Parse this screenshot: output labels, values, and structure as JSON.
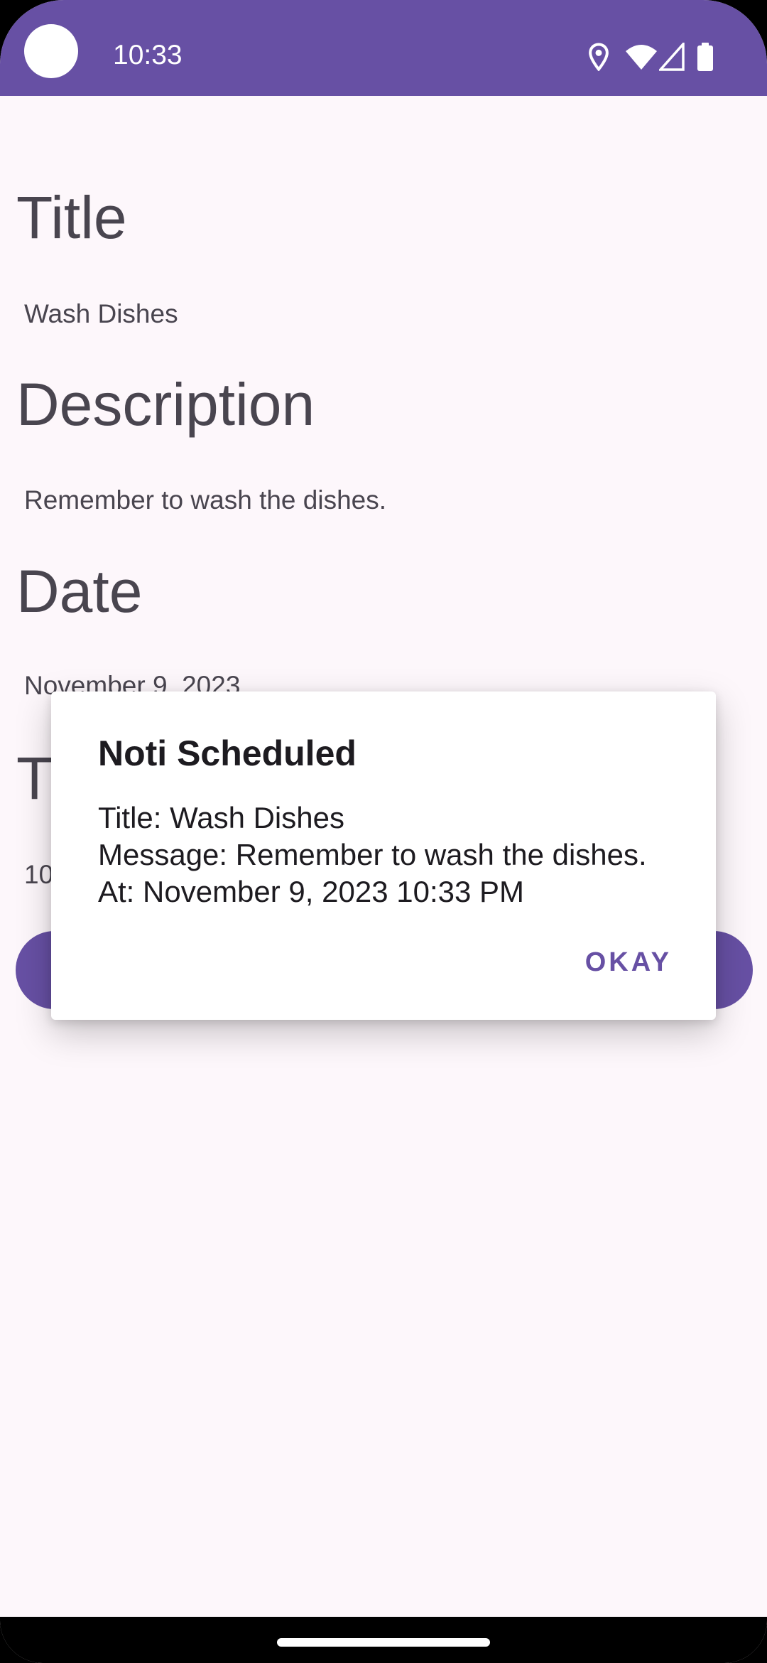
{
  "status_bar": {
    "time": "10:33",
    "icons": [
      "location-icon",
      "wifi-icon",
      "cellular-signal-icon",
      "battery-icon"
    ],
    "background": "#6750a4"
  },
  "form": {
    "title_heading": "Title",
    "title_value": "Wash Dishes",
    "description_heading": "Description",
    "description_value": "Remember to wash the dishes.",
    "date_heading": "Date",
    "date_value": "November 9, 2023",
    "time_heading": "Time",
    "time_value": "10:33 PM"
  },
  "dialog": {
    "title": "Noti Scheduled",
    "line_title": "Title: Wash Dishes",
    "line_message": "Message: Remember to wash the dishes.",
    "line_at": "At: November 9, 2023 10:33 PM",
    "ok_label": "OKAY"
  },
  "colors": {
    "accent": "#6750a4",
    "background": "#fdf7fb",
    "text_secondary": "#49454f",
    "text_primary": "#1d1b20"
  }
}
